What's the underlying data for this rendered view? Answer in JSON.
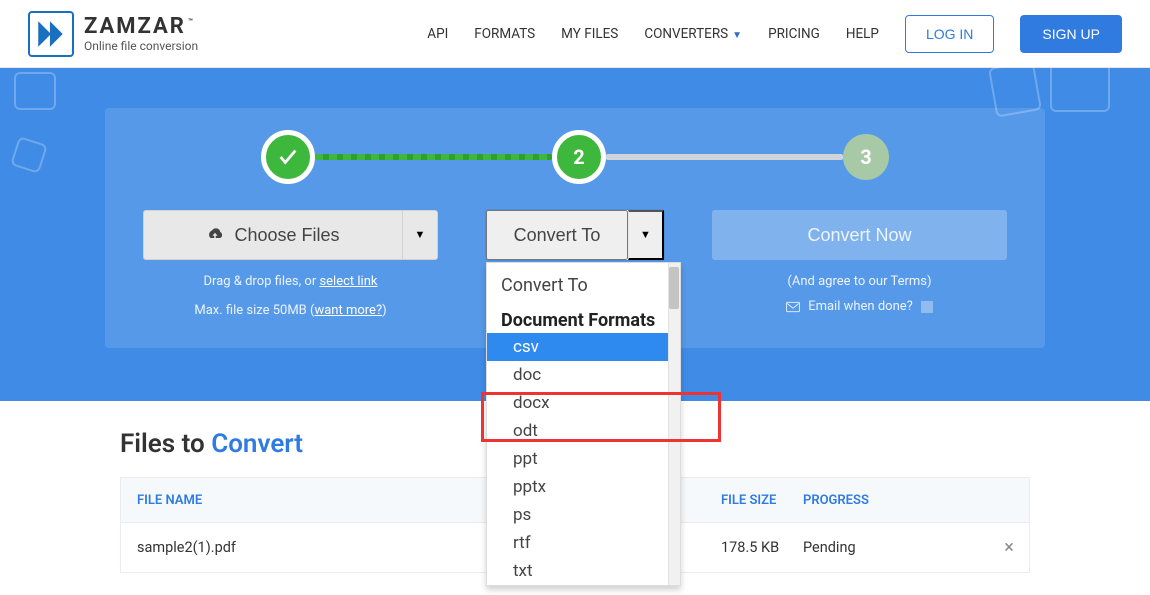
{
  "logo": {
    "name": "ZAMZAR",
    "tagline": "Online file conversion"
  },
  "nav": {
    "api": "API",
    "formats": "FORMATS",
    "myfiles": "MY FILES",
    "converters": "CONVERTERS",
    "pricing": "PRICING",
    "help": "HELP",
    "login": "LOG IN",
    "signup": "SIGN UP"
  },
  "steps": {
    "two": "2",
    "three": "3"
  },
  "choose": {
    "label": "Choose Files",
    "hint_pre": "Drag & drop files, or ",
    "hint_link": "select link",
    "max_pre": "Max. file size 50MB (",
    "max_link": "want more?",
    "max_post": ")"
  },
  "convert": {
    "label": "Convert To"
  },
  "dropdown": {
    "title": "Convert To",
    "group": "Document Formats",
    "items": [
      "csv",
      "doc",
      "docx",
      "odt",
      "ppt",
      "pptx",
      "ps",
      "rtf",
      "txt"
    ]
  },
  "convertNow": {
    "label": "Convert Now",
    "terms_pre": "(And agree to our ",
    "terms_link": "Terms",
    "terms_post": ")",
    "email": "Email when done?"
  },
  "files": {
    "title_pre": "Files to ",
    "title_accent": "Convert",
    "headers": {
      "name": "FILE NAME",
      "size": "FILE SIZE",
      "progress": "PROGRESS"
    },
    "rows": [
      {
        "name": "sample2(1).pdf",
        "size": "178.5 KB",
        "progress": "Pending"
      }
    ]
  }
}
